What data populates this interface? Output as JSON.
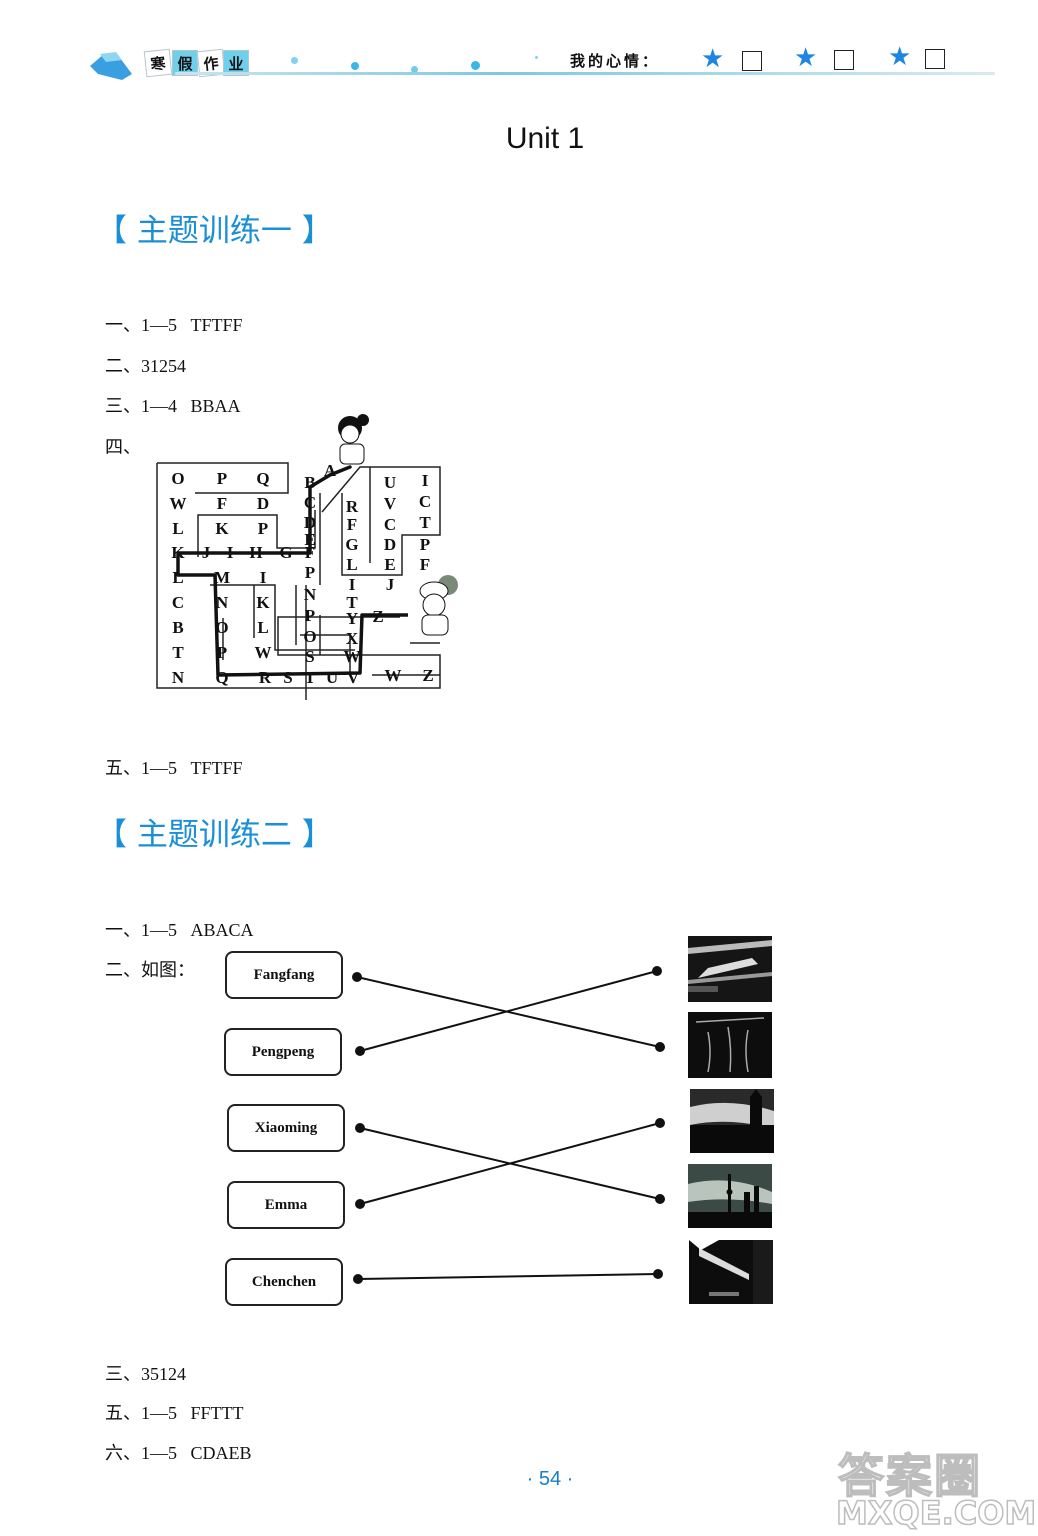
{
  "header": {
    "book_title_chars": [
      "寒",
      "假",
      "作",
      "业"
    ],
    "mood_label": "我的心情：",
    "mood_options": [
      {
        "icon": "star-icon",
        "checked": false
      },
      {
        "icon": "star-icon",
        "checked": false
      },
      {
        "icon": "star-icon",
        "checked": false
      }
    ],
    "accent_color": "#1a8fd8"
  },
  "unit_title": "Unit 1",
  "sections": [
    {
      "title": "【 主题训练一 】",
      "answers": [
        {
          "label": "一、1—5",
          "value": "TFTFF"
        },
        {
          "label": "二、31254",
          "value": ""
        },
        {
          "label": "三、1—4",
          "value": "BBAA"
        },
        {
          "label": "四、",
          "value": ""
        },
        {
          "label": "五、1—5",
          "value": "TFTFF"
        }
      ],
      "maze": {
        "letters": [
          [
            "O",
            "P",
            "Q"
          ],
          [
            "W",
            "F",
            "D"
          ],
          [
            "L",
            "K",
            "P"
          ],
          [
            "K",
            "J",
            "I",
            "H",
            "G"
          ],
          [
            "L",
            "M",
            "I"
          ],
          [
            "C",
            "N",
            "K"
          ],
          [
            "B",
            "O",
            "L"
          ],
          [
            "T",
            "P",
            "W"
          ],
          [
            "N",
            "Q",
            "R",
            "S",
            "T",
            "U",
            "V",
            "W",
            "Z"
          ],
          [
            "B",
            "C",
            "D",
            "E",
            "F",
            "P",
            "N",
            "P",
            "O",
            "S"
          ],
          [
            "A"
          ],
          [
            "R",
            "F",
            "G",
            "L",
            "I",
            "T",
            "Y",
            "X",
            "W"
          ],
          [
            "Z"
          ],
          [
            "U",
            "V",
            "C",
            "D",
            "E",
            "J"
          ],
          [
            "I",
            "C",
            "T",
            "P",
            "F"
          ]
        ],
        "path_description": "A → B → C → D → E → F → G → H → I → J → K → L → M → N → O → P → Q → R → S → T → U → V → W → X → Y → Z"
      }
    },
    {
      "title": "【 主题训练二 】",
      "answers": [
        {
          "label": "一、1—5",
          "value": "ABACA"
        },
        {
          "label": "二、如图：",
          "value": ""
        },
        {
          "label": "三、35124",
          "value": ""
        },
        {
          "label": "五、1—5",
          "value": "FFTTT"
        },
        {
          "label": "六、1—5",
          "value": "CDAEB"
        }
      ],
      "matching": {
        "names": [
          "Fangfang",
          "Pengpeng",
          "Xiaoming",
          "Emma",
          "Chenchen"
        ],
        "pictures": [
          "Tiananmen (gate tower)",
          "Terracotta warriors",
          "Big Ben / Houses of Parliament",
          "Shanghai skyline (Oriental Pearl Tower)",
          "Street with old buildings"
        ],
        "links": [
          {
            "name": "Fangfang",
            "picture_index": 2
          },
          {
            "name": "Pengpeng",
            "picture_index": 1
          },
          {
            "name": "Xiaoming",
            "picture_index": 4
          },
          {
            "name": "Emma",
            "picture_index": 3
          },
          {
            "name": "Chenchen",
            "picture_index": 5
          }
        ]
      }
    }
  ],
  "page_number": "· 54 ·",
  "watermark": {
    "line1": "答案圈",
    "line2": "MXQE.COM"
  }
}
